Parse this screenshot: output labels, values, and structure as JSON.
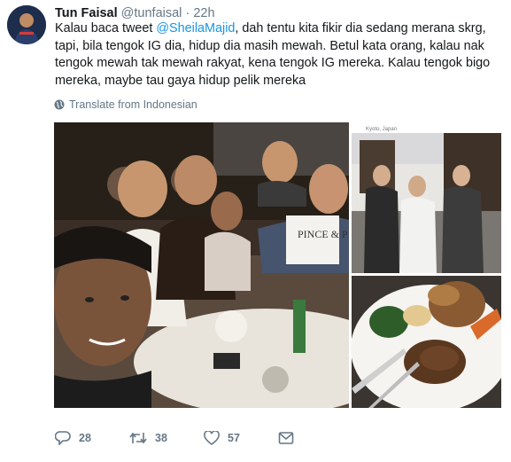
{
  "tweet": {
    "author_name": "Tun Faisal",
    "handle": "@tunfaisal",
    "separator": "·",
    "time": "22h",
    "text_before": "Kalau baca tweet ",
    "mention": "@SheilaMajid",
    "text_after": ", dah tentu kita fikir dia sedang merana skrg, tapi, bila tengok IG dia, hidup dia masih mewah. Betul kata orang, kalau nak tengok mewah tak mewah rakyat, kena tengok IG mereka. Kalau tengok bigo mereka, maybe tau gaya hidup pelik mereka",
    "translate_label": "Translate from Indonesian",
    "photo_left_sign_text": "PINCE & P",
    "photo_right_header_text": "Kyoto, Japan",
    "colors": {
      "link": "#1b95e0",
      "secondary": "#657786",
      "text": "#14171a"
    }
  },
  "actions": {
    "reply_count": "28",
    "retweet_count": "38",
    "like_count": "57",
    "icons": [
      "reply-icon",
      "retweet-icon",
      "like-icon",
      "dm-icon"
    ]
  }
}
